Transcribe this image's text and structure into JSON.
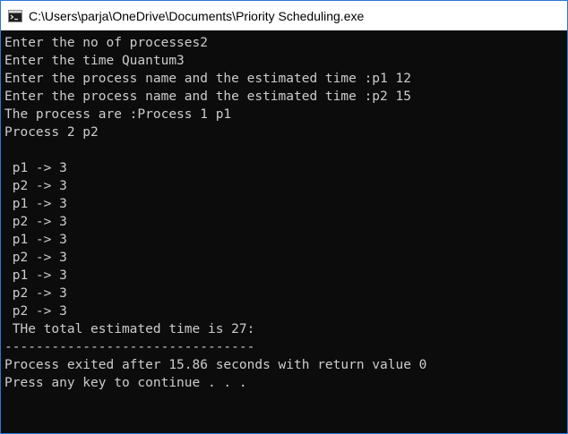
{
  "window": {
    "title": "C:\\Users\\parja\\OneDrive\\Documents\\Priority Scheduling.exe",
    "icon": "console-app-icon"
  },
  "console": {
    "lines": [
      "Enter the no of processes2",
      "Enter the time Quantum3",
      "Enter the process name and the estimated time :p1 12",
      "Enter the process name and the estimated time :p2 15",
      "The process are :Process 1 p1",
      "Process 2 p2",
      "",
      " p1 -> 3",
      " p2 -> 3",
      " p1 -> 3",
      " p2 -> 3",
      " p1 -> 3",
      " p2 -> 3",
      " p1 -> 3",
      " p2 -> 3",
      " p2 -> 3",
      " THe total estimated time is 27:",
      "--------------------------------",
      "Process exited after 15.86 seconds with return value 0",
      "Press any key to continue . . ."
    ]
  },
  "colors": {
    "console_background": "#0c0c0c",
    "console_text": "#cccccc",
    "titlebar_background": "#ffffff",
    "window_border": "#2b78d6"
  }
}
